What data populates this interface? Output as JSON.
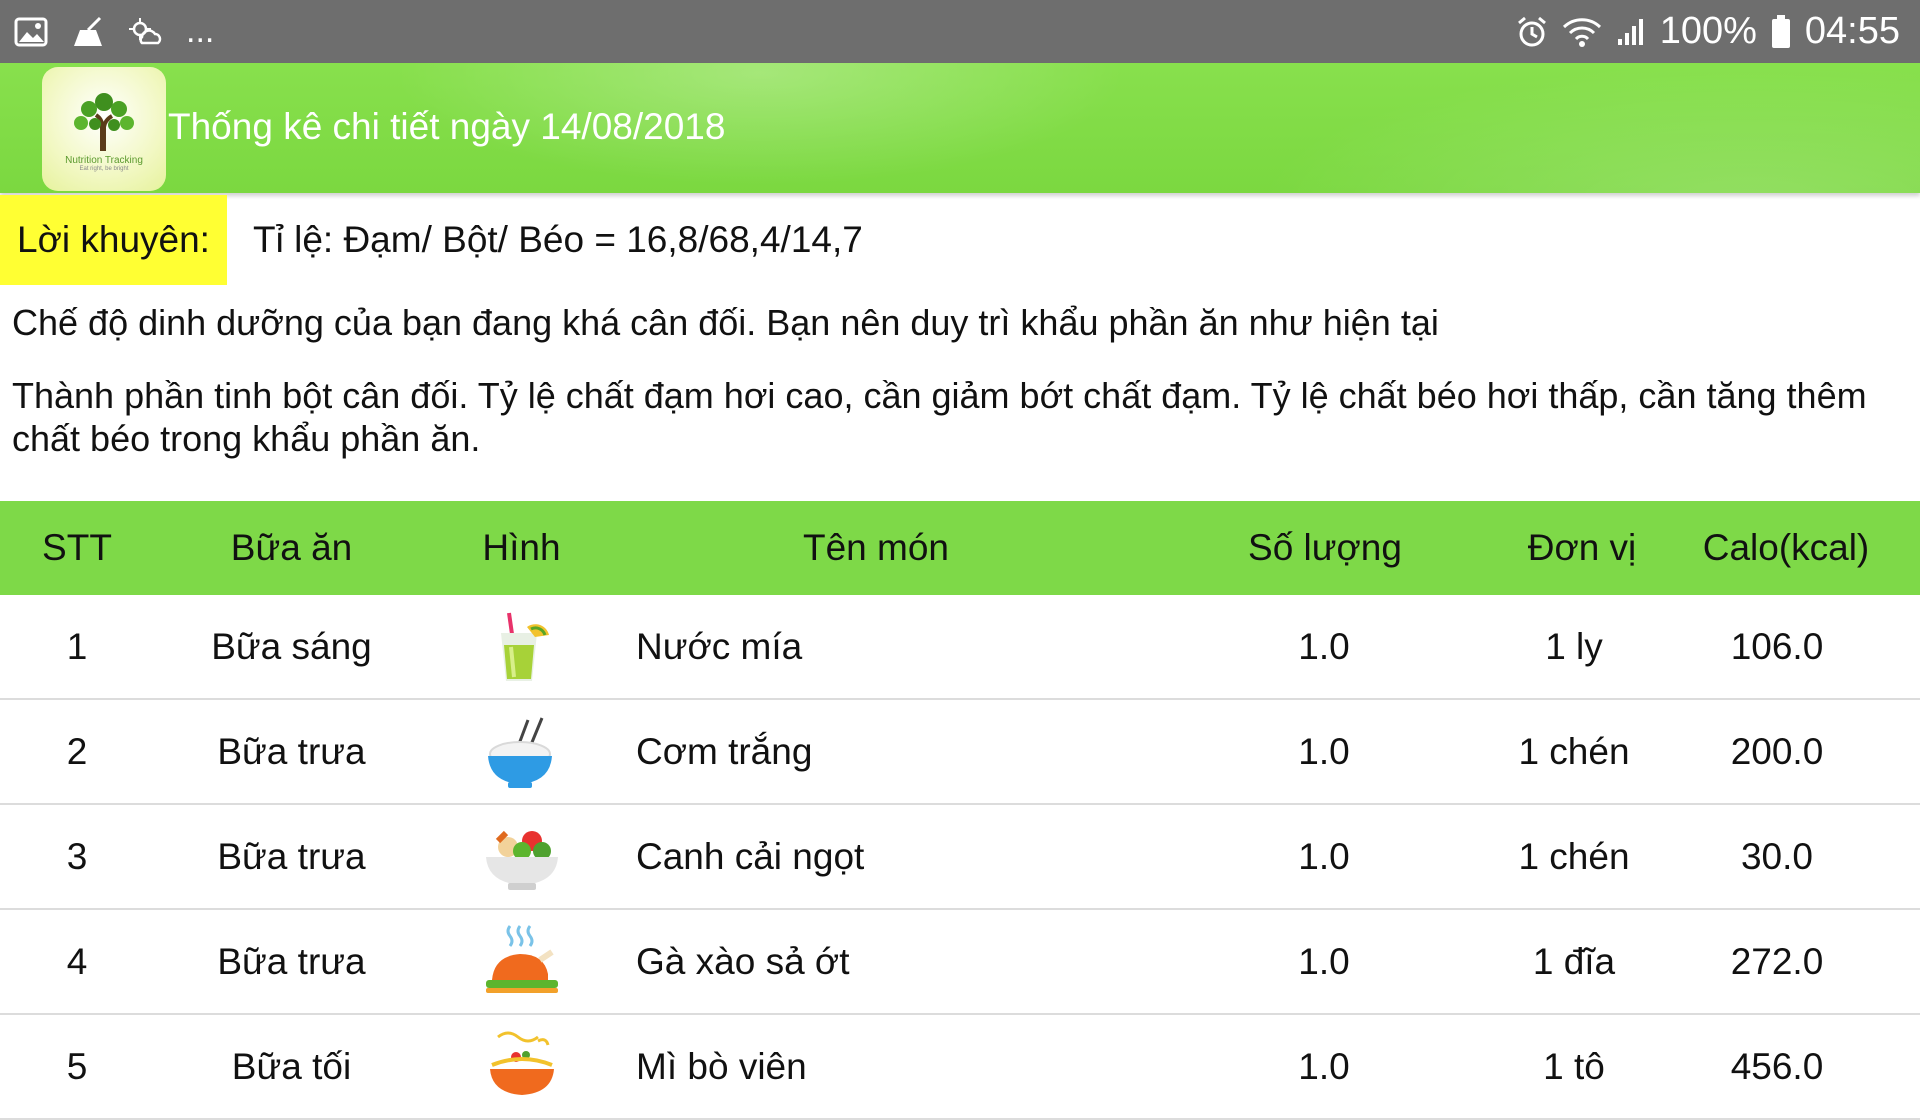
{
  "status_bar": {
    "battery": "100%",
    "time": "04:55",
    "more": "..."
  },
  "header": {
    "title": "Thống kê chi tiết ngày 14/08/2018",
    "logo_text": "Nutrition Tracking",
    "logo_sub": "Eat right, be bright"
  },
  "advice": {
    "label": "Lời khuyên:",
    "ratio": "Tỉ lệ: Đạm/ Bột/ Béo = 16,8/68,4/14,7",
    "line1": "Chế độ dinh dưỡng của bạn đang khá cân đối. Bạn nên duy trì khẩu phần ăn như hiện tại",
    "line2": "Thành phần tinh bột cân đối. Tỷ lệ chất đạm hơi cao, cần giảm bớt chất đạm. Tỷ lệ chất béo hơi thấp, cần tăng thêm chất béo trong khẩu phần ăn."
  },
  "table": {
    "headers": {
      "stt": "STT",
      "meal": "Bữa ăn",
      "image": "Hình",
      "name": "Tên món",
      "qty": "Số lượng",
      "unit": "Đơn vị",
      "cal": "Calo(kcal)"
    },
    "rows": [
      {
        "stt": "1",
        "meal": "Bữa sáng",
        "icon": "juice-glass-icon",
        "name": "Nước mía",
        "qty": "1.0",
        "unit": "1 ly",
        "cal": "106.0"
      },
      {
        "stt": "2",
        "meal": "Bữa trưa",
        "icon": "rice-bowl-icon",
        "name": "Cơm trắng",
        "qty": "1.0",
        "unit": "1 chén",
        "cal": "200.0"
      },
      {
        "stt": "3",
        "meal": "Bữa trưa",
        "icon": "salad-bowl-icon",
        "name": "Canh cải ngọt",
        "qty": "1.0",
        "unit": "1 chén",
        "cal": "30.0"
      },
      {
        "stt": "4",
        "meal": "Bữa trưa",
        "icon": "roast-chicken-icon",
        "name": "Gà xào sả ớt",
        "qty": "1.0",
        "unit": "1 đĩa",
        "cal": "272.0"
      },
      {
        "stt": "5",
        "meal": "Bữa tối",
        "icon": "noodle-bowl-icon",
        "name": "Mì bò viên",
        "qty": "1.0",
        "unit": "1 tô",
        "cal": "456.0"
      }
    ]
  },
  "colors": {
    "header_green": "#7bd840",
    "table_header_green": "#7ed948",
    "advice_yellow": "#ffff33",
    "status_gray": "#6e6e6e"
  }
}
